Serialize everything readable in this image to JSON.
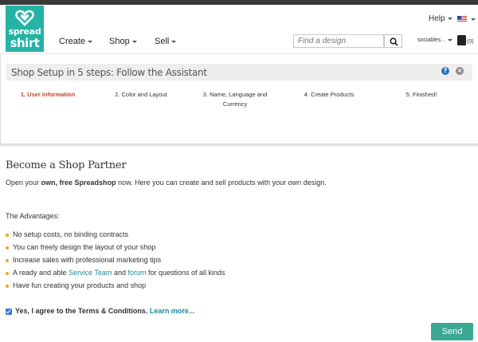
{
  "header": {
    "logo_line1": "spread",
    "logo_line2": "shirt",
    "help_label": "Help",
    "nav": [
      {
        "label": "Create"
      },
      {
        "label": "Shop"
      },
      {
        "label": "Sell"
      }
    ],
    "search_placeholder": "Find a design",
    "account_label": "sociables...",
    "cart_count": "(0)"
  },
  "assistant": {
    "title": "Shop Setup in 5 steps: Follow the Assistant",
    "steps": [
      {
        "label": "1. User Information",
        "active": true
      },
      {
        "label": "2. Color and Layout",
        "active": false
      },
      {
        "label": "3. Name, Language and Currency",
        "active": false
      },
      {
        "label": "4. Create Products",
        "active": false
      },
      {
        "label": "5. Finished!",
        "active": false
      }
    ]
  },
  "partner": {
    "title": "Become a Shop Partner",
    "intro_pre": "Open your ",
    "intro_bold": "own, free Spreadshop",
    "intro_post": " now. Here you can create and sell products with your own design.",
    "advantages_heading": "The Advantages:",
    "advantages": [
      "No setup costs, no binding contracts",
      "You can freely design the layout of your shop",
      "Increase sales with professional marketing tips",
      "A ready and able",
      "Have fun creating your products and shop"
    ],
    "adv4_link1": "Service Team",
    "adv4_mid": " and ",
    "adv4_link2": "forum",
    "adv4_post": " for questions of all kinds",
    "agree_text": "Yes, I agree to the Terms & Conditions.",
    "learn_more": "Learn more...",
    "send_label": "Send"
  },
  "colors": {
    "brand": "#25b3a5",
    "active_step": "#c0452a",
    "link": "#1a8aa0",
    "send": "#3aa893"
  }
}
